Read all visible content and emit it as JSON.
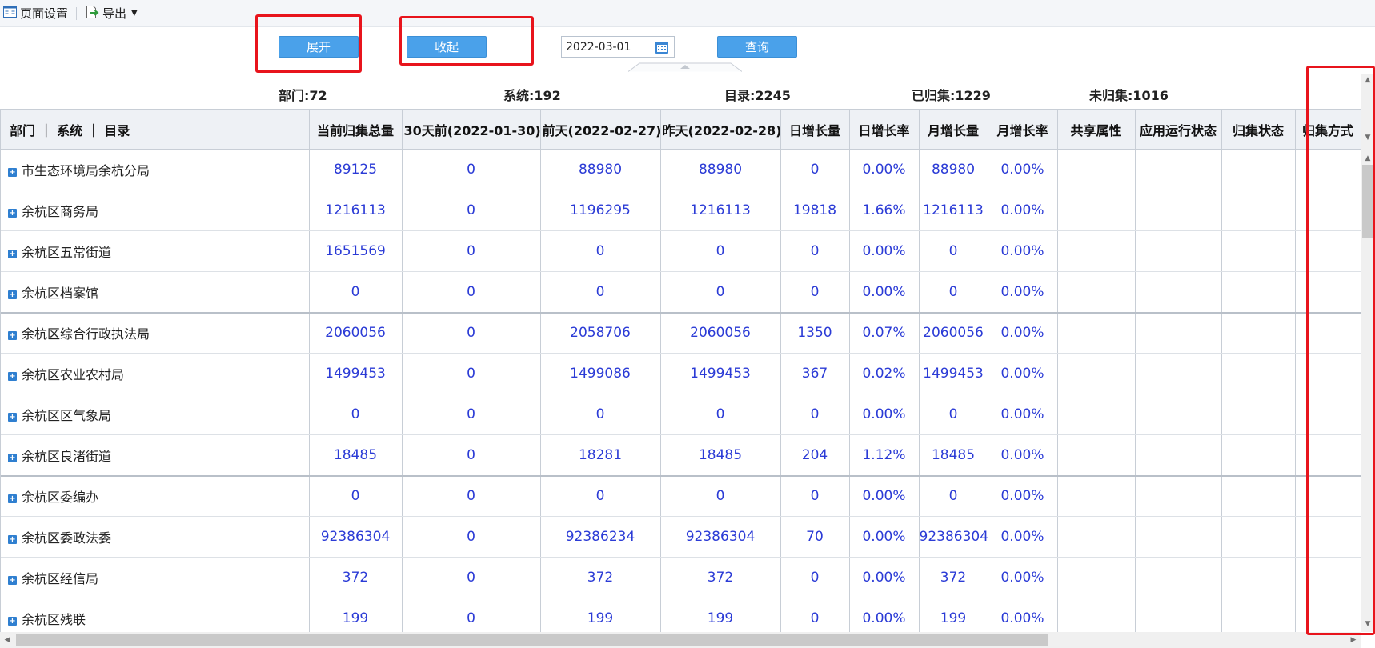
{
  "toolbar": {
    "page_setup_label": "页面设置",
    "export_label": "导出"
  },
  "controls": {
    "expand_label": "展开",
    "collapse_label": "收起",
    "date_value": "2022-03-01",
    "query_label": "查询"
  },
  "stats": {
    "departments": "部门:72",
    "systems": "系统:192",
    "catalogs": "目录:2245",
    "collected": "已归集:1229",
    "uncollected": "未归集:1016"
  },
  "table": {
    "columns": [
      "部门 ｜ 系统 ｜ 目录",
      "当前归集总量",
      "30天前(2022-01-30)",
      "前天(2022-02-27)",
      "昨天(2022-02-28)",
      "日增长量",
      "日增长率",
      "月增长量",
      "月增长率",
      "共享属性",
      "应用运行状态",
      "归集状态",
      "归集方式"
    ],
    "rows": [
      [
        "市生态环境局余杭分局",
        "89125",
        "0",
        "88980",
        "88980",
        "0",
        "0.00%",
        "88980",
        "0.00%",
        "",
        "",
        "",
        ""
      ],
      [
        "余杭区商务局",
        "1216113",
        "0",
        "1196295",
        "1216113",
        "19818",
        "1.66%",
        "1216113",
        "0.00%",
        "",
        "",
        "",
        ""
      ],
      [
        "余杭区五常街道",
        "1651569",
        "0",
        "0",
        "0",
        "0",
        "0.00%",
        "0",
        "0.00%",
        "",
        "",
        "",
        ""
      ],
      [
        "余杭区档案馆",
        "0",
        "0",
        "0",
        "0",
        "0",
        "0.00%",
        "0",
        "0.00%",
        "",
        "",
        "",
        ""
      ],
      [
        "余杭区综合行政执法局",
        "2060056",
        "0",
        "2058706",
        "2060056",
        "1350",
        "0.07%",
        "2060056",
        "0.00%",
        "",
        "",
        "",
        ""
      ],
      [
        "余杭区农业农村局",
        "1499453",
        "0",
        "1499086",
        "1499453",
        "367",
        "0.02%",
        "1499453",
        "0.00%",
        "",
        "",
        "",
        ""
      ],
      [
        "余杭区区气象局",
        "0",
        "0",
        "0",
        "0",
        "0",
        "0.00%",
        "0",
        "0.00%",
        "",
        "",
        "",
        ""
      ],
      [
        "余杭区良渚街道",
        "18485",
        "0",
        "18281",
        "18485",
        "204",
        "1.12%",
        "18485",
        "0.00%",
        "",
        "",
        "",
        ""
      ],
      [
        "余杭区委编办",
        "0",
        "0",
        "0",
        "0",
        "0",
        "0.00%",
        "0",
        "0.00%",
        "",
        "",
        "",
        ""
      ],
      [
        "余杭区委政法委",
        "92386304",
        "0",
        "92386234",
        "92386304",
        "70",
        "0.00%",
        "92386304",
        "0.00%",
        "",
        "",
        "",
        ""
      ],
      [
        "余杭区经信局",
        "372",
        "0",
        "372",
        "372",
        "0",
        "0.00%",
        "372",
        "0.00%",
        "",
        "",
        "",
        ""
      ],
      [
        "余杭区残联",
        "199",
        "0",
        "199",
        "199",
        "0",
        "0.00%",
        "199",
        "0.00%",
        "",
        "",
        "",
        ""
      ]
    ]
  },
  "colors": {
    "button": "#4aa1ea",
    "value_text": "#2b3bd6",
    "annotation": "#e8141c"
  }
}
